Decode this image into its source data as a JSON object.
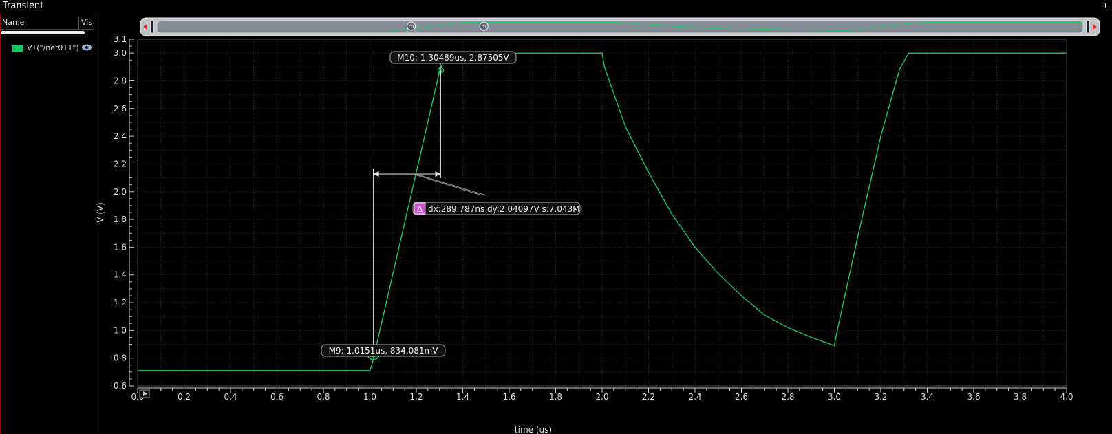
{
  "window": {
    "title": "Transient",
    "index": "1"
  },
  "browser": {
    "col_name": "Name",
    "col_vis": "Vis",
    "signals": [
      {
        "name": "VT(\"/net011\")",
        "color": "#17c964",
        "icon": "eye-icon"
      }
    ]
  },
  "overview": {
    "marker_glyph": "m"
  },
  "colors": {
    "trace": "#17c964",
    "grid": "#2a2a2a",
    "marker_line": "#e8e8e8",
    "delta_badge": "#cc55cc"
  },
  "chart_data": {
    "type": "line",
    "xlabel": "time (us)",
    "ylabel": "V (V)",
    "xlim": [
      0.0,
      4.0
    ],
    "ylim": [
      0.6,
      3.1
    ],
    "x_ticks": [
      0.0,
      0.2,
      0.4,
      0.6,
      0.8,
      1.0,
      1.2,
      1.4,
      1.6,
      1.8,
      2.0,
      2.2,
      2.4,
      2.6,
      2.8,
      3.0,
      3.2,
      3.4,
      3.6,
      3.8,
      4.0
    ],
    "x_tick_labels": [
      "0.0",
      "0.2",
      "0.4",
      "0.6",
      "0.8",
      "1.0",
      "1.2",
      "1.4",
      "1.6",
      "1.8",
      "2.0",
      "2.2",
      "2.4",
      "2.6",
      "2.8",
      "3.0",
      "3.2",
      "3.4",
      "3.6",
      "3.8",
      "4.0"
    ],
    "y_ticks": [
      0.6,
      0.8,
      1.0,
      1.2,
      1.4,
      1.6,
      1.8,
      2.0,
      2.2,
      2.4,
      2.6,
      2.8,
      3.0,
      3.1
    ],
    "y_tick_labels": [
      "0.6",
      "0.8",
      "1.0",
      "1.2",
      "1.4",
      "1.6",
      "1.8",
      "2.0",
      "2.2",
      "2.4",
      "2.6",
      "2.8",
      "3.0",
      "3.1"
    ],
    "grid": true,
    "series": [
      {
        "name": "VT(\"/net011\")",
        "x": [
          0.0,
          1.0,
          1.01,
          1.3,
          1.33,
          2.0,
          2.01,
          2.1,
          2.2,
          2.3,
          2.4,
          2.5,
          2.6,
          2.7,
          2.8,
          2.9,
          3.0,
          3.01,
          3.1,
          3.2,
          3.28,
          3.32,
          3.4,
          4.0
        ],
        "y": [
          0.71,
          0.71,
          0.76,
          2.87,
          3.0,
          3.0,
          2.9,
          2.47,
          2.14,
          1.84,
          1.6,
          1.41,
          1.25,
          1.11,
          1.02,
          0.95,
          0.89,
          0.98,
          1.67,
          2.4,
          2.88,
          3.0,
          3.0,
          3.0
        ]
      }
    ],
    "markers": [
      {
        "id": "M10",
        "x": 1.30489,
        "y": 2.87505,
        "label": "M10: 1.30489us, 2.87505V"
      },
      {
        "id": "M9",
        "x": 1.0151,
        "y": 0.834081,
        "label": "M9: 1.0151us, 834.081mV"
      }
    ],
    "delta": {
      "label": "dx:289.787ns dy:2.04097V s:7.043M",
      "badge": "Δ"
    }
  }
}
